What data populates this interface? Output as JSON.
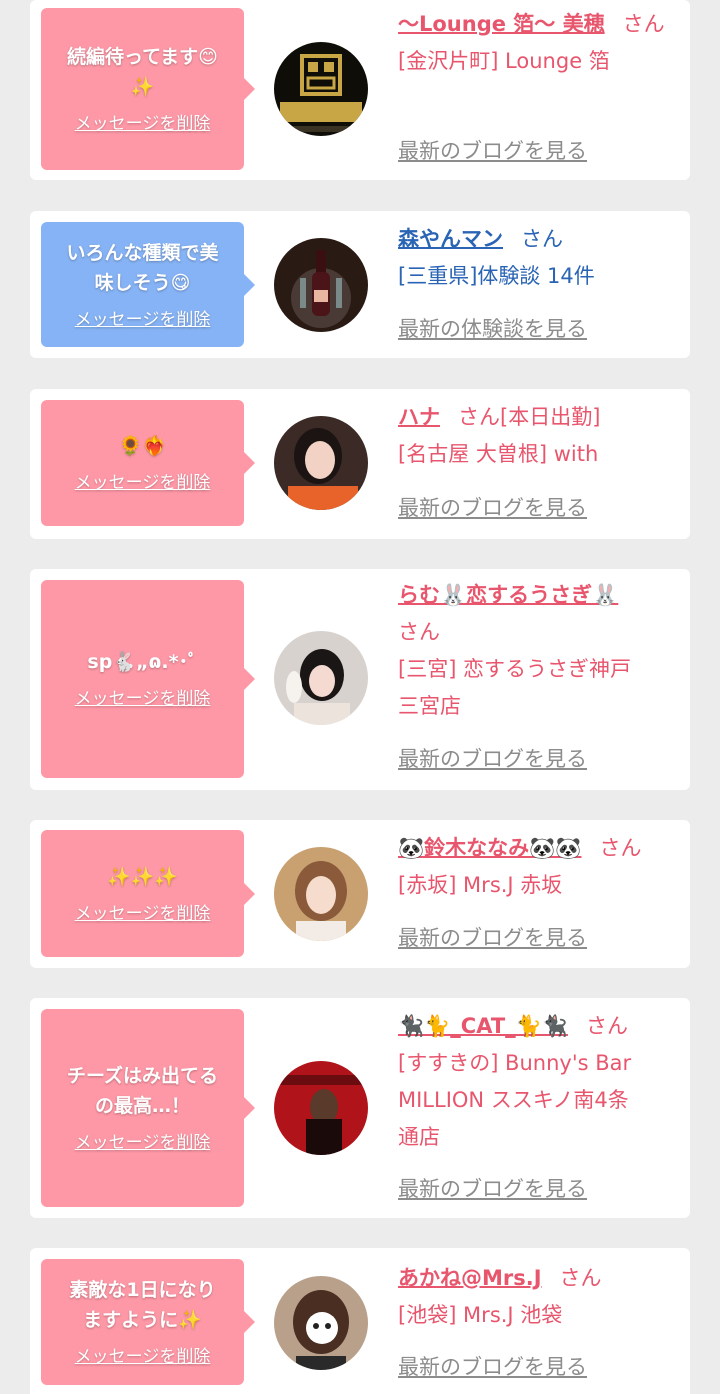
{
  "colors": {
    "page_bg": "#ececec",
    "card_bg": "#ffffff",
    "bubble_pink": "#fe98a6",
    "bubble_blue": "#86b3f5",
    "name_pink": "#e8566d",
    "name_blue": "#2a64b4",
    "link_gray": "#8c8c8c"
  },
  "delete_label": "メッセージを削除",
  "san_label": "さん",
  "items": [
    {
      "message": "続編待ってます😊\n✨",
      "bubble_color": "pink",
      "name": "〜Lounge 箔〜 美穂",
      "honorific": "さん",
      "location_lines": [
        "[金沢片町] Lounge 箔"
      ],
      "link": "最新のブログを見る",
      "avatar": "lounge-logo-avatar"
    },
    {
      "message": "いろんな種類で美\n味しそう😋",
      "bubble_color": "blue",
      "name": "森やんマン",
      "honorific": "さん",
      "location_lines": [
        "[三重県]体験談 14件"
      ],
      "link": "最新の体験談を見る",
      "avatar": "champagne-avatar"
    },
    {
      "message": "🌻❤️‍🔥",
      "bubble_color": "pink",
      "name": "ハナ",
      "honorific": "さん[本日出勤]",
      "location_lines": [
        "[名古屋 大曽根] with"
      ],
      "link": "最新のブログを見る",
      "avatar": "woman-photo-avatar"
    },
    {
      "message": "sp🐇„ɷ.*･ﾟ",
      "bubble_color": "pink",
      "name": "らむ🐰恋するうさぎ🐰",
      "honorific": "さん",
      "location_lines": [
        "[三宮] 恋するうさぎ神戸",
        "三宮店"
      ],
      "link": "最新のブログを見る",
      "avatar": "woman-photo-avatar"
    },
    {
      "message": "✨✨✨",
      "bubble_color": "pink",
      "name": "🐼鈴木ななみ🐼🐼",
      "honorific": "さん",
      "location_lines": [
        "[赤坂] Mrs.J 赤坂"
      ],
      "link": "最新のブログを見る",
      "avatar": "woman-photo-avatar"
    },
    {
      "message": "チーズはみ出てる\nの最高…！",
      "bubble_color": "pink",
      "name": "🐈‍⬛🐈_CAT_🐈🐈‍⬛",
      "honorific": "さん",
      "location_lines": [
        "[すすきの] Bunny's Bar",
        "MILLION ススキノ南4条",
        "通店"
      ],
      "link": "最新のブログを見る",
      "avatar": "woman-photo-avatar"
    },
    {
      "message": "素敵な1日になり\nますように✨",
      "bubble_color": "pink",
      "name": "あかね@Mrs.J",
      "honorific": "さん",
      "location_lines": [
        "[池袋] Mrs.J 池袋"
      ],
      "link": "最新のブログを見る",
      "avatar": "woman-photo-avatar"
    }
  ]
}
